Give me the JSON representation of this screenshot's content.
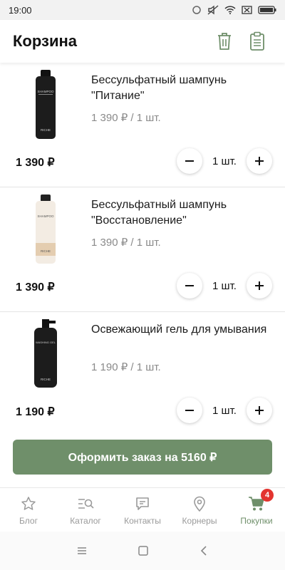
{
  "status_bar": {
    "time": "19:00"
  },
  "app_bar": {
    "title": "Корзина",
    "actions": [
      "trash-icon",
      "clipboard-icon"
    ]
  },
  "cart_items": [
    {
      "name": "Бессульфатный шампунь \"Питание\"",
      "unit_price": "1 390 ₽ / 1 шт.",
      "total": "1 390 ₽",
      "quantity": "1 шт.",
      "bottle_label": "SHAMPOO",
      "bottle_brand": "RICHE",
      "bottle_color": "#1c1c1c"
    },
    {
      "name": "Бессульфатный шампунь \"Восстановление\"",
      "unit_price": "1 390 ₽ / 1 шт.",
      "total": "1 390 ₽",
      "quantity": "1 шт.",
      "bottle_label": "SHAMPOO",
      "bottle_brand": "RICHE",
      "bottle_color": "#f3ece3"
    },
    {
      "name": "Освежающий гель для умывания",
      "unit_price": "1 190 ₽ / 1 шт.",
      "total": "1 190 ₽",
      "quantity": "1 шт.",
      "bottle_label": "WASHING GEL",
      "bottle_brand": "RICHE",
      "bottle_color": "#1c1c1c"
    }
  ],
  "checkout": {
    "label": "Оформить заказ на 5160 ₽"
  },
  "tabs": [
    {
      "label": "Блог",
      "icon": "star-icon"
    },
    {
      "label": "Каталог",
      "icon": "catalog-search-icon"
    },
    {
      "label": "Контакты",
      "icon": "chat-icon"
    },
    {
      "label": "Корнеры",
      "icon": "location-pin-icon"
    },
    {
      "label": "Покупки",
      "icon": "cart-icon",
      "badge": "4",
      "active": true
    }
  ],
  "colors": {
    "accent": "#6f8f6a",
    "badge": "#e3342f",
    "muted_text": "#8a8a8a"
  }
}
